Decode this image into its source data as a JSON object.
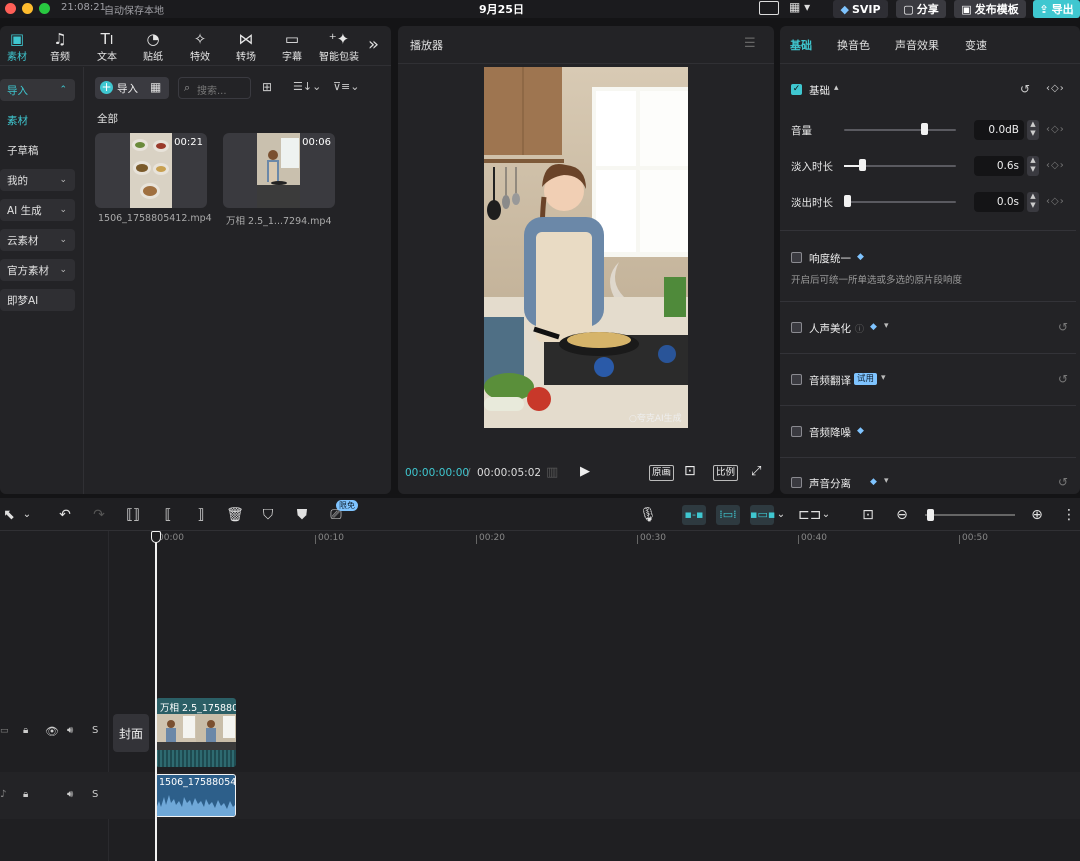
{
  "titlebar": {
    "time": "21:08:21",
    "autosave": "自动保存本地",
    "project_title": "9月25日",
    "svip": "SVIP",
    "share": "分享",
    "publish_template": "发布模板",
    "export": "导出"
  },
  "colors": {
    "accent": "#3fc7d0",
    "blue_clip": "#2d5f8a"
  },
  "toolbar": {
    "items": [
      {
        "label": "素材",
        "icon": "media-icon"
      },
      {
        "label": "音频",
        "icon": "audio-icon"
      },
      {
        "label": "文本",
        "icon": "text-icon"
      },
      {
        "label": "贴纸",
        "icon": "sticker-icon"
      },
      {
        "label": "特效",
        "icon": "effects-icon"
      },
      {
        "label": "转场",
        "icon": "transition-icon"
      },
      {
        "label": "字幕",
        "icon": "subtitle-icon"
      },
      {
        "label": "智能包装",
        "icon": "smart-pack-icon"
      }
    ]
  },
  "sidebar": {
    "items": [
      {
        "label": "导入"
      },
      {
        "label": "素材"
      },
      {
        "label": "子草稿"
      },
      {
        "label": "我的"
      },
      {
        "label": "AI 生成"
      },
      {
        "label": "云素材"
      },
      {
        "label": "官方素材"
      },
      {
        "label": "即梦AI"
      }
    ]
  },
  "media": {
    "import_label": "导入",
    "search_placeholder": "搜索...",
    "section_all": "全部",
    "files": [
      {
        "duration": "00:21",
        "name": "1506_1758805412.mp4"
      },
      {
        "duration": "00:06",
        "name": "万相 2.5_1...7294.mp4"
      }
    ]
  },
  "player": {
    "title": "播放器",
    "watermark": "夸克AI生成",
    "current_time": "00:00:00:00",
    "total_time": "00:00:05:02",
    "original_label": "原画",
    "ratio_label": "比例"
  },
  "inspector": {
    "tabs": [
      "基础",
      "换音色",
      "声音效果",
      "变速"
    ],
    "basic_section": "基础",
    "volume_label": "音量",
    "volume_value": "0.0dB",
    "volume_level": 0.73,
    "fadein_label": "淡入时长",
    "fadein_value": "0.6s",
    "fadein_level": 0.14,
    "fadeout_label": "淡出时长",
    "fadeout_value": "0.0s",
    "fadeout_level": 0.0,
    "loudness_label": "响度统一",
    "loudness_desc": "开启后可统一所单选或多选的原片段响度",
    "voice_enhance_label": "人声美化",
    "audio_translate_label": "音频翻译",
    "trial_badge": "试用",
    "denoise_label": "音频降噪",
    "vocal_separation_label": "声音分离"
  },
  "timeline": {
    "free_badge": "限免",
    "ticks": [
      "00:00",
      "00:10",
      "00:20",
      "00:30",
      "00:40",
      "00:50"
    ],
    "cover_label": "封面",
    "video_clip_name": "万相 2.5_1758805",
    "audio_clip_name": "1506_1758805412",
    "track_solo": "S"
  }
}
